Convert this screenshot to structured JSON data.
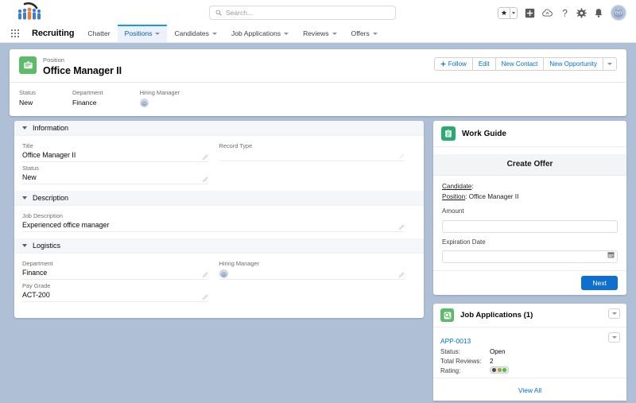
{
  "global_header": {
    "logo_name": "recruiting-app-logo",
    "search": {
      "placeholder": "Search...",
      "value": ""
    },
    "icons": [
      {
        "name": "favorites-star-icon",
        "glyph": "★"
      },
      {
        "name": "favorites-caret-icon",
        "glyph": "▾"
      },
      {
        "name": "add-plus-icon",
        "glyph": "+"
      },
      {
        "name": "cloud-icon",
        "glyph": "☁"
      },
      {
        "name": "help-question-icon",
        "glyph": "?"
      },
      {
        "name": "setup-gear-icon",
        "glyph": "⚙"
      },
      {
        "name": "notifications-bell-icon",
        "glyph": "🔔"
      },
      {
        "name": "user-avatar",
        "glyph": ""
      }
    ]
  },
  "nav": {
    "app_launcher": "app-launcher-waffle",
    "app_name": "Recruiting",
    "tabs": [
      {
        "label": "Chatter",
        "has_caret": false,
        "active": false
      },
      {
        "label": "Positions",
        "has_caret": true,
        "active": true
      },
      {
        "label": "Candidates",
        "has_caret": true,
        "active": false
      },
      {
        "label": "Job Applications",
        "has_caret": true,
        "active": false
      },
      {
        "label": "Reviews",
        "has_caret": true,
        "active": false
      },
      {
        "label": "Offers",
        "has_caret": true,
        "active": false
      }
    ]
  },
  "record_header": {
    "object_label": "Position",
    "record_name": "Office Manager II",
    "actions": [
      {
        "label": "Follow",
        "icon": "plus-icon"
      },
      {
        "label": "Edit",
        "icon": ""
      },
      {
        "label": "New Contact",
        "icon": ""
      },
      {
        "label": "New Opportunity",
        "icon": ""
      }
    ],
    "more_actions_label": "▾",
    "highlight_fields": [
      {
        "label": "Status",
        "value": "New",
        "type": "text"
      },
      {
        "label": "Department",
        "value": "Finance",
        "type": "text"
      },
      {
        "label": "Hiring Manager",
        "value": "",
        "type": "avatar"
      }
    ]
  },
  "detail": {
    "sections": [
      {
        "title": "Information",
        "fields": [
          {
            "label": "Title",
            "value": "Office Manager II",
            "editable": true,
            "col": "left"
          },
          {
            "label": "Record Type",
            "value": "",
            "editable": true,
            "col": "right"
          },
          {
            "label": "Status",
            "value": "New",
            "editable": true,
            "col": "left"
          }
        ]
      },
      {
        "title": "Description",
        "fields": [
          {
            "label": "Job Description",
            "value": "Experienced office manager",
            "editable": true,
            "col": "full"
          }
        ]
      },
      {
        "title": "Logistics",
        "fields": [
          {
            "label": "Department",
            "value": "Finance",
            "editable": true,
            "col": "left"
          },
          {
            "label": "Hiring Manager",
            "value": "",
            "editable": true,
            "col": "right",
            "type": "avatar"
          },
          {
            "label": "Pay Grade",
            "value": "ACT-200",
            "editable": true,
            "col": "left"
          }
        ]
      }
    ]
  },
  "work_guide": {
    "title": "Work Guide",
    "icon": "clipboard-icon",
    "banner": "Create Offer",
    "candidate_label": "Candidate",
    "candidate_value": "",
    "position_label": "Position",
    "position_value": "Office Manager II",
    "amount_label": "Amount",
    "amount_value": "",
    "expiration_label": "Expiration Date",
    "expiration_value": "",
    "next_label": "Next"
  },
  "job_applications": {
    "title": "Job Applications (1)",
    "icon": "job-application-icon",
    "menu_label": "▾",
    "record": {
      "name": "APP-0013",
      "rows": [
        {
          "label": "Status:",
          "value": "Open"
        },
        {
          "label": "Total Reviews:",
          "value": "2"
        },
        {
          "label": "Rating:",
          "value": ""
        }
      ],
      "rating_dots": [
        "#4a4a4a",
        "#a8a23c",
        "#3fc243"
      ]
    },
    "view_all_label": "View All"
  },
  "colors": {
    "page_background": "#aebfd6",
    "brand_blue": "#0070d2",
    "active_tab_blue": "#1b96ff",
    "position_icon_green": "#5ebb6a",
    "work_guide_green": "#2aa971",
    "next_button_blue": "#0e6fd0"
  }
}
